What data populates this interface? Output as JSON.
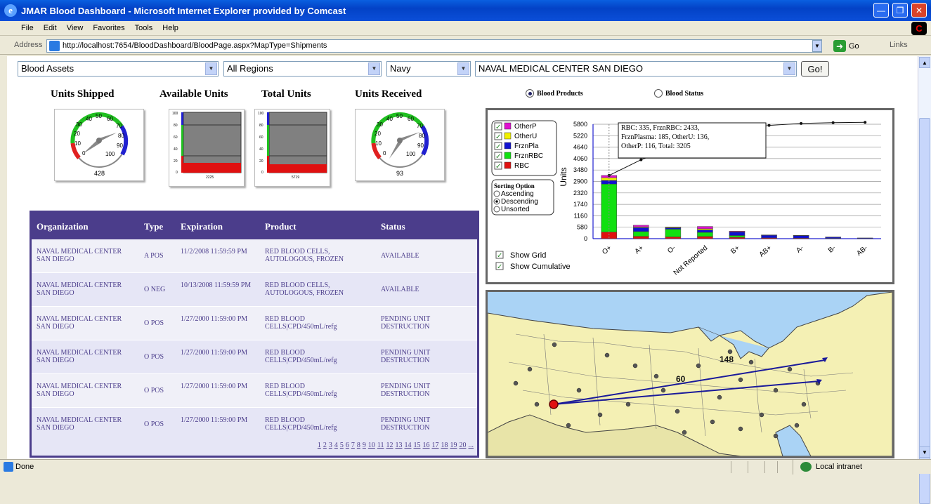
{
  "window": {
    "title": "JMAR Blood Dashboard - Microsoft Internet Explorer provided by Comcast"
  },
  "menu": [
    "File",
    "Edit",
    "View",
    "Favorites",
    "Tools",
    "Help"
  ],
  "address": {
    "label": "Address",
    "url": "http://localhost:7654/BloodDashboard/BloodPage.aspx?MapType=Shipments",
    "go": "Go",
    "links": "Links"
  },
  "filters": {
    "asset": "Blood Assets",
    "region": "All Regions",
    "service": "Navy",
    "facility": "NAVAL MEDICAL CENTER SAN DIEGO",
    "go": "Go!"
  },
  "gauges": {
    "shipped": {
      "title": "Units Shipped",
      "value": "428",
      "ticks": [
        "0",
        "10",
        "20",
        "30",
        "40",
        "50",
        "60",
        "70",
        "80",
        "90",
        "100"
      ]
    },
    "available": {
      "title": "Available Units",
      "value": "2225",
      "ticks": [
        "100",
        "80",
        "60",
        "40",
        "20",
        "0"
      ]
    },
    "total": {
      "title": "Total Units",
      "value": "5719",
      "ticks": [
        "100",
        "80",
        "60",
        "40",
        "20",
        "0"
      ]
    },
    "received": {
      "title": "Units Received",
      "value": "93",
      "ticks": [
        "0",
        "10",
        "20",
        "30",
        "40",
        "50",
        "60",
        "70",
        "80",
        "90",
        "100"
      ]
    }
  },
  "view_options": {
    "products": "Blood Products",
    "status": "Blood Status"
  },
  "table": {
    "headers": [
      "Organization",
      "Type",
      "Expiration",
      "Product",
      "Status"
    ],
    "rows": [
      {
        "org": "NAVAL MEDICAL CENTER SAN DIEGO",
        "type": "A POS",
        "exp": "11/2/2008 11:59:59 PM",
        "product": "RED BLOOD CELLS, AUTOLOGOUS, FROZEN",
        "status": "AVAILABLE"
      },
      {
        "org": "NAVAL MEDICAL CENTER SAN DIEGO",
        "type": "O NEG",
        "exp": "10/13/2008 11:59:59 PM",
        "product": "RED BLOOD CELLS, AUTOLOGOUS, FROZEN",
        "status": "AVAILABLE"
      },
      {
        "org": "NAVAL MEDICAL CENTER SAN DIEGO",
        "type": "O POS",
        "exp": "1/27/2000 11:59:00 PM",
        "product": "RED BLOOD CELLS|CPD/450mL/refg",
        "status": "PENDING UNIT DESTRUCTION"
      },
      {
        "org": "NAVAL MEDICAL CENTER SAN DIEGO",
        "type": "O POS",
        "exp": "1/27/2000 11:59:00 PM",
        "product": "RED BLOOD CELLS|CPD/450mL/refg",
        "status": "PENDING UNIT DESTRUCTION"
      },
      {
        "org": "NAVAL MEDICAL CENTER SAN DIEGO",
        "type": "O POS",
        "exp": "1/27/2000 11:59:00 PM",
        "product": "RED BLOOD CELLS|CPD/450mL/refg",
        "status": "PENDING UNIT DESTRUCTION"
      },
      {
        "org": "NAVAL MEDICAL CENTER SAN DIEGO",
        "type": "O POS",
        "exp": "1/27/2000 11:59:00 PM",
        "product": "RED BLOOD CELLS|CPD/450mL/refg",
        "status": "PENDING UNIT DESTRUCTION"
      }
    ],
    "pages": [
      "1",
      "2",
      "3",
      "4",
      "5",
      "6",
      "7",
      "8",
      "9",
      "10",
      "11",
      "12",
      "13",
      "14",
      "15",
      "16",
      "17",
      "18",
      "19",
      "20",
      "..."
    ]
  },
  "chart_data": {
    "type": "bar",
    "stacked": true,
    "ylabel": "Units",
    "ylim": [
      0,
      5800
    ],
    "yticks": [
      "0",
      "580",
      "1160",
      "1740",
      "2320",
      "2900",
      "3480",
      "4060",
      "4640",
      "5220",
      "5800"
    ],
    "categories": [
      "O+",
      "A+",
      "O-",
      "Not Reported",
      "B+",
      "AB+",
      "A-",
      "B-",
      "AB-"
    ],
    "series": [
      {
        "name": "RBC",
        "color": "#e01010",
        "values": [
          335,
          120,
          90,
          110,
          70,
          40,
          30,
          15,
          8
        ]
      },
      {
        "name": "FrznRBC",
        "color": "#10e010",
        "values": [
          2433,
          240,
          390,
          210,
          90,
          0,
          0,
          0,
          0
        ]
      },
      {
        "name": "FrznPlasma",
        "color": "#1010d0",
        "values": [
          185,
          200,
          60,
          120,
          170,
          130,
          120,
          60,
          30
        ]
      },
      {
        "name": "OtherU",
        "color": "#f0f000",
        "values": [
          136,
          40,
          30,
          60,
          20,
          10,
          10,
          5,
          0
        ]
      },
      {
        "name": "OtherP",
        "color": "#e010d0",
        "values": [
          116,
          80,
          20,
          120,
          30,
          10,
          10,
          5,
          0
        ]
      }
    ],
    "cumulative": [
      3205,
      4000,
      4600,
      5150,
      5550,
      5740,
      5840,
      5880,
      5900
    ],
    "legend": [
      "OtherP",
      "OtherU",
      "FrznPla",
      "FrznRBC",
      "RBC"
    ],
    "tooltip": [
      "RBC: 335,   FrznRBC: 2433,",
      "FrznPlasma: 185,   OtherU: 136,",
      "OtherP: 116,   Total: 3205"
    ],
    "sorting": {
      "title": "Sorting Option",
      "options": [
        "Ascending",
        "Descending",
        "Unsorted"
      ],
      "selected": "Descending"
    },
    "show_grid": "Show Grid",
    "show_cumulative": "Show Cumulative"
  },
  "map": {
    "labels": [
      "148",
      "60"
    ]
  },
  "status": {
    "text": "Done",
    "zone": "Local intranet"
  }
}
